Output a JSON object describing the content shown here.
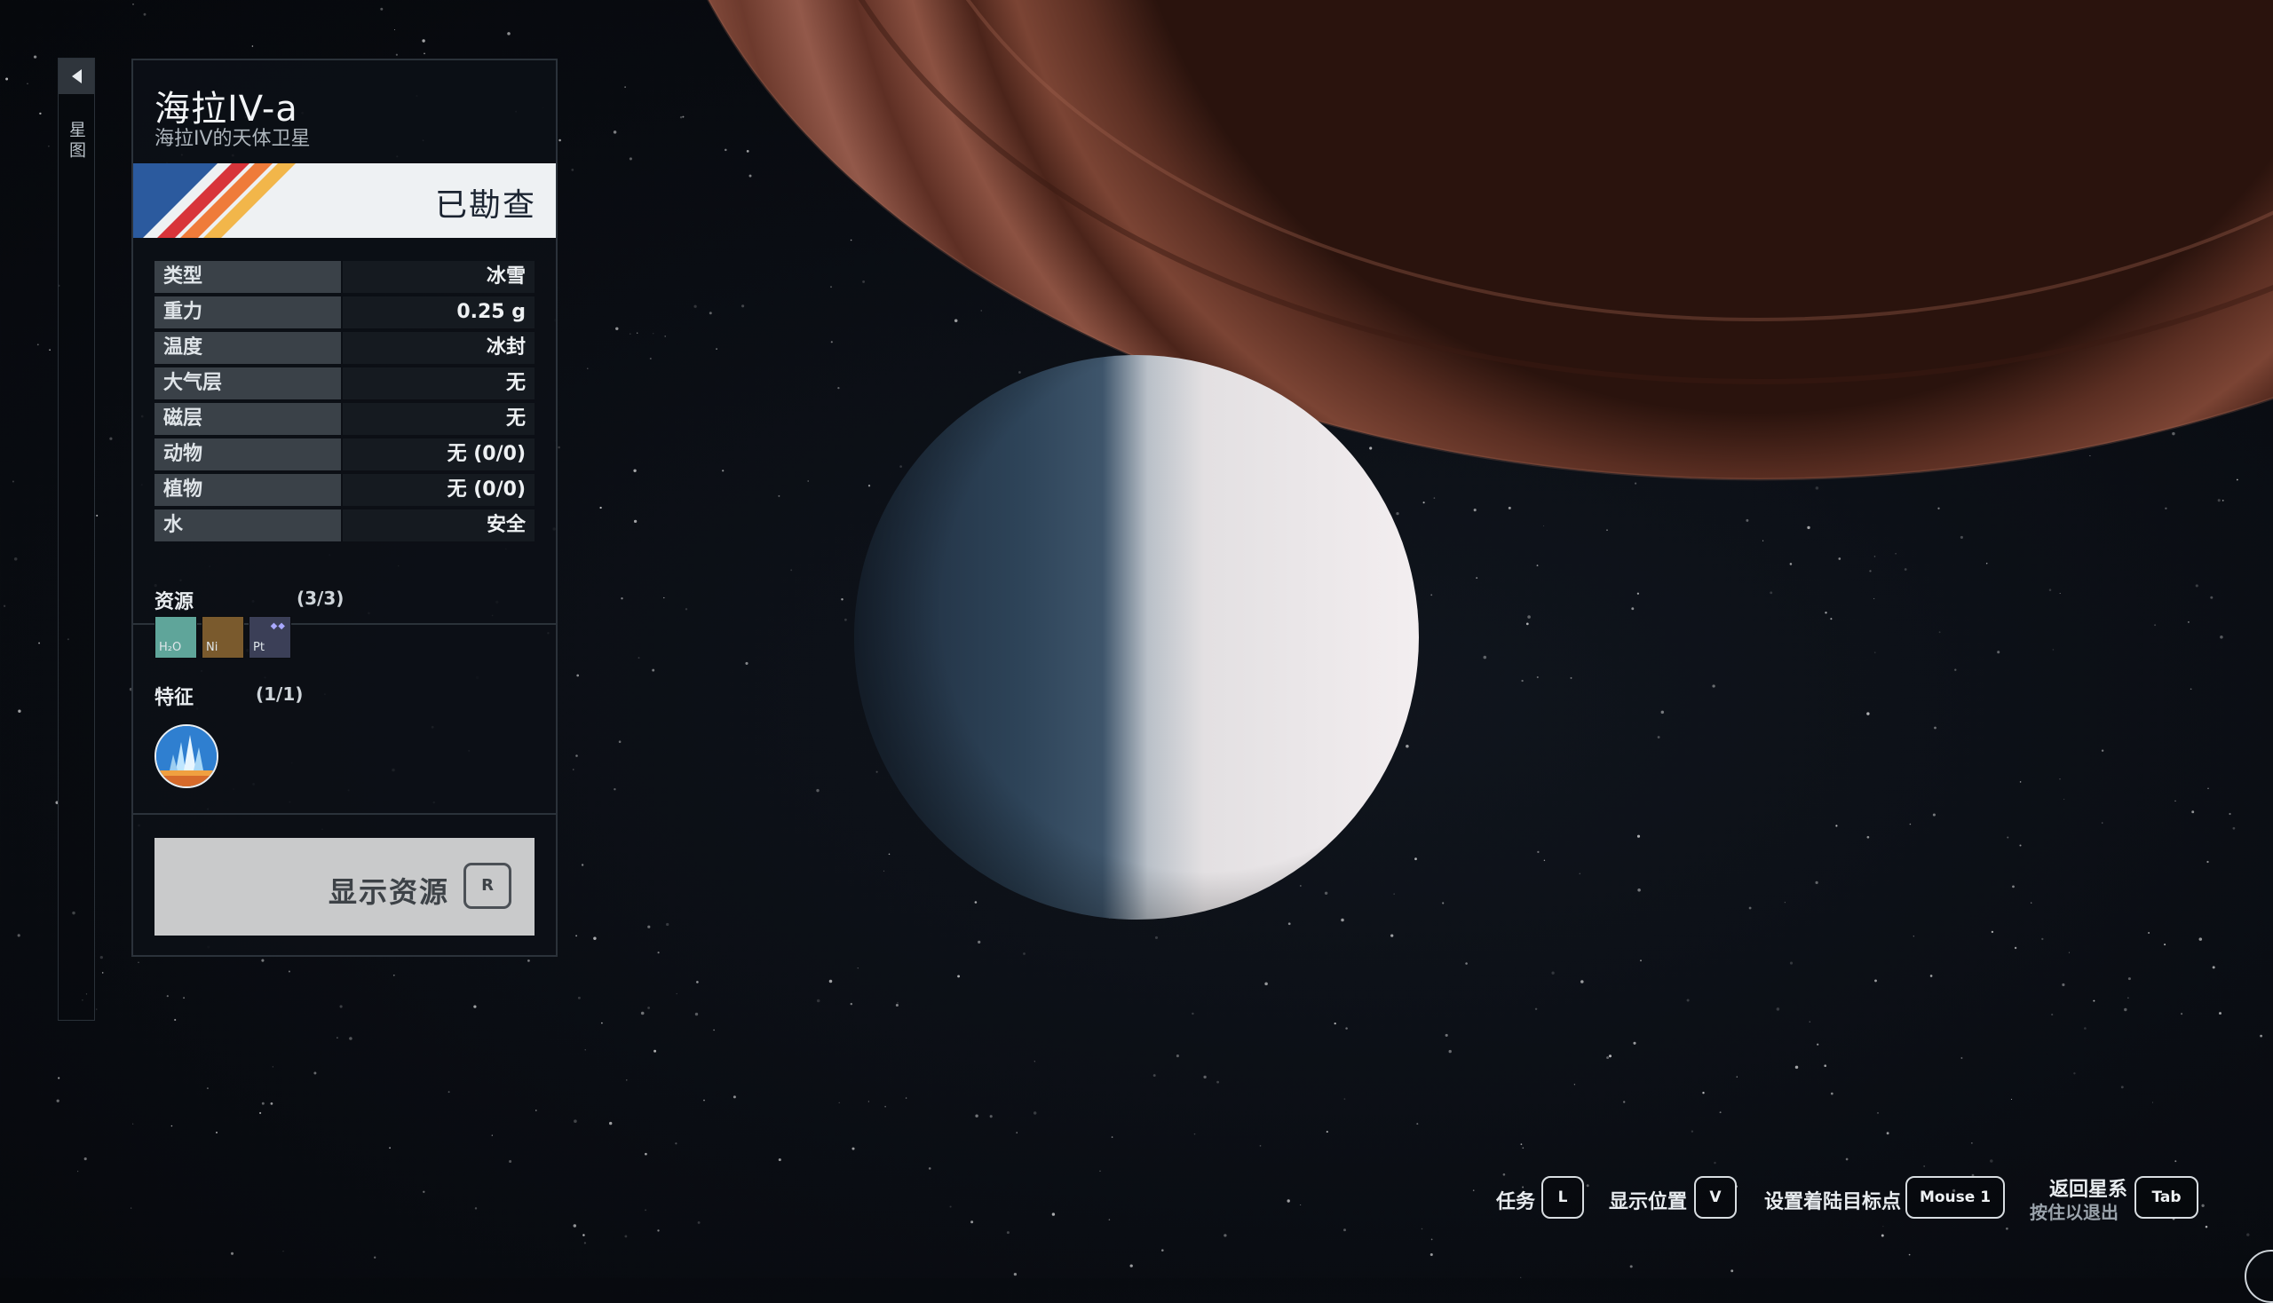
{
  "rail": {
    "label": "星图"
  },
  "body": {
    "name": "海拉IV-a",
    "subtitle": "海拉IV的天体卫星",
    "status": "已勘查",
    "properties": [
      {
        "label": "类型",
        "value": "冰雪"
      },
      {
        "label": "重力",
        "value": "0.25 g"
      },
      {
        "label": "温度",
        "value": "冰封"
      },
      {
        "label": "大气层",
        "value": "无"
      },
      {
        "label": "磁层",
        "value": "无"
      },
      {
        "label": "动物",
        "value": "无 (0/0)"
      },
      {
        "label": "植物",
        "value": "无 (0/0)"
      },
      {
        "label": "水",
        "value": "安全"
      }
    ],
    "resources_label": "资源",
    "resources_count": "(3/3)",
    "resources": [
      {
        "symbol": "H₂O",
        "color": "#5fa59a"
      },
      {
        "symbol": "Ni",
        "color": "#7a5a2d"
      },
      {
        "symbol": "Pt",
        "color": "#3b3f57"
      }
    ],
    "traits_label": "特征",
    "traits_count": "(1/1)",
    "trait_icon": "ice-crystal-icon",
    "show_resources_label": "显示资源",
    "show_resources_key": "R"
  },
  "hints": {
    "mission": {
      "label": "任务",
      "key": "L"
    },
    "show_location": {
      "label": "显示位置",
      "key": "V"
    },
    "set_landing": {
      "label": "设置着陆目标点",
      "key": "Mouse 1"
    },
    "return": {
      "label": "返回星系",
      "sub": "按住以退出",
      "key": "Tab"
    }
  },
  "colors": {
    "planet_light": "#e9e4e6",
    "planet_dark": "#2b3d52",
    "ring": "#6b3b2c",
    "stripe_red": "#d8343a",
    "stripe_orange": "#ef7b3a",
    "stripe_yellow": "#f2b64a",
    "stripe_blue": "#2b5a9e"
  }
}
